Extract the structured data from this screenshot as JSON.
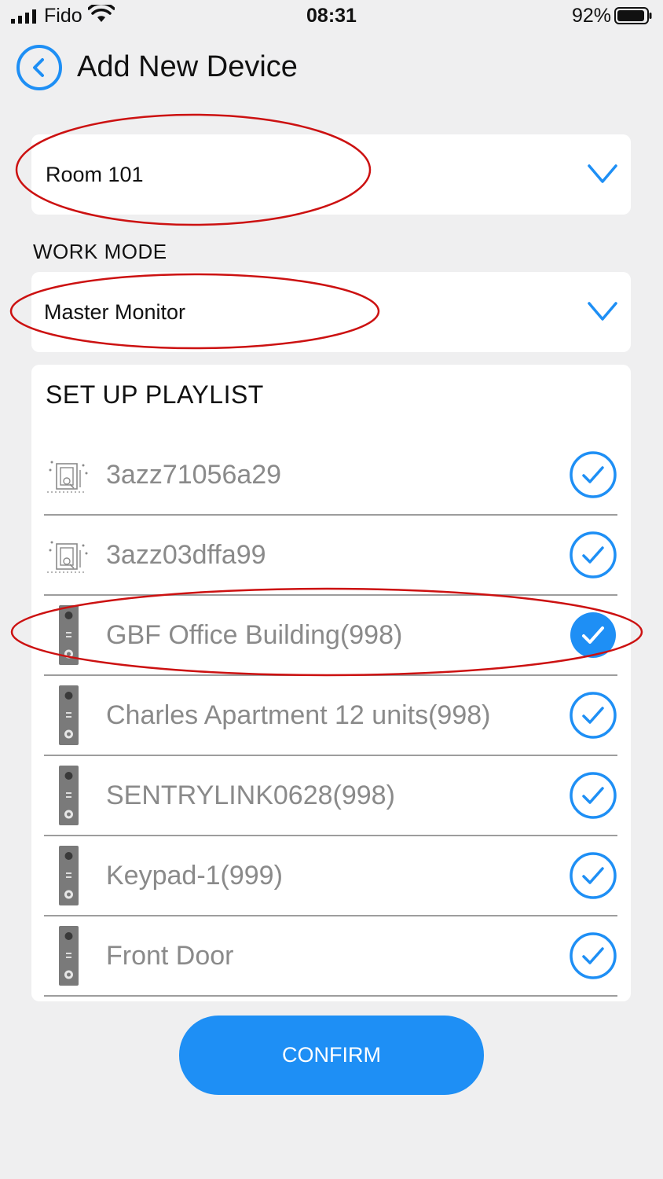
{
  "status_bar": {
    "carrier": "Fido",
    "time": "08:31",
    "battery": "92%"
  },
  "header": {
    "title": "Add New Device"
  },
  "room_select": {
    "value": "Room 101"
  },
  "work_mode": {
    "label": "WORK MODE",
    "value": "Master Monitor"
  },
  "playlist": {
    "title": "SET UP PLAYLIST",
    "items": [
      {
        "label": "3azz71056a29",
        "icon": "monitor-device-icon",
        "checked": false
      },
      {
        "label": "3azz03dffa99",
        "icon": "monitor-device-icon",
        "checked": false
      },
      {
        "label": "GBF Office Building(998)",
        "icon": "doorbell-device-icon",
        "checked": true
      },
      {
        "label": "Charles Apartment 12 units(998)",
        "icon": "doorbell-device-icon",
        "checked": false
      },
      {
        "label": "SENTRYLINK0628(998)",
        "icon": "doorbell-device-icon",
        "checked": false
      },
      {
        "label": "Keypad-1(999)",
        "icon": "doorbell-device-icon",
        "checked": false
      },
      {
        "label": "Front Door",
        "icon": "doorbell-device-icon",
        "checked": false
      }
    ]
  },
  "confirm_button": {
    "label": "CONFIRM"
  },
  "colors": {
    "accent": "#1e8ff5",
    "annotation": "#cc1111",
    "background": "#efeff0"
  }
}
